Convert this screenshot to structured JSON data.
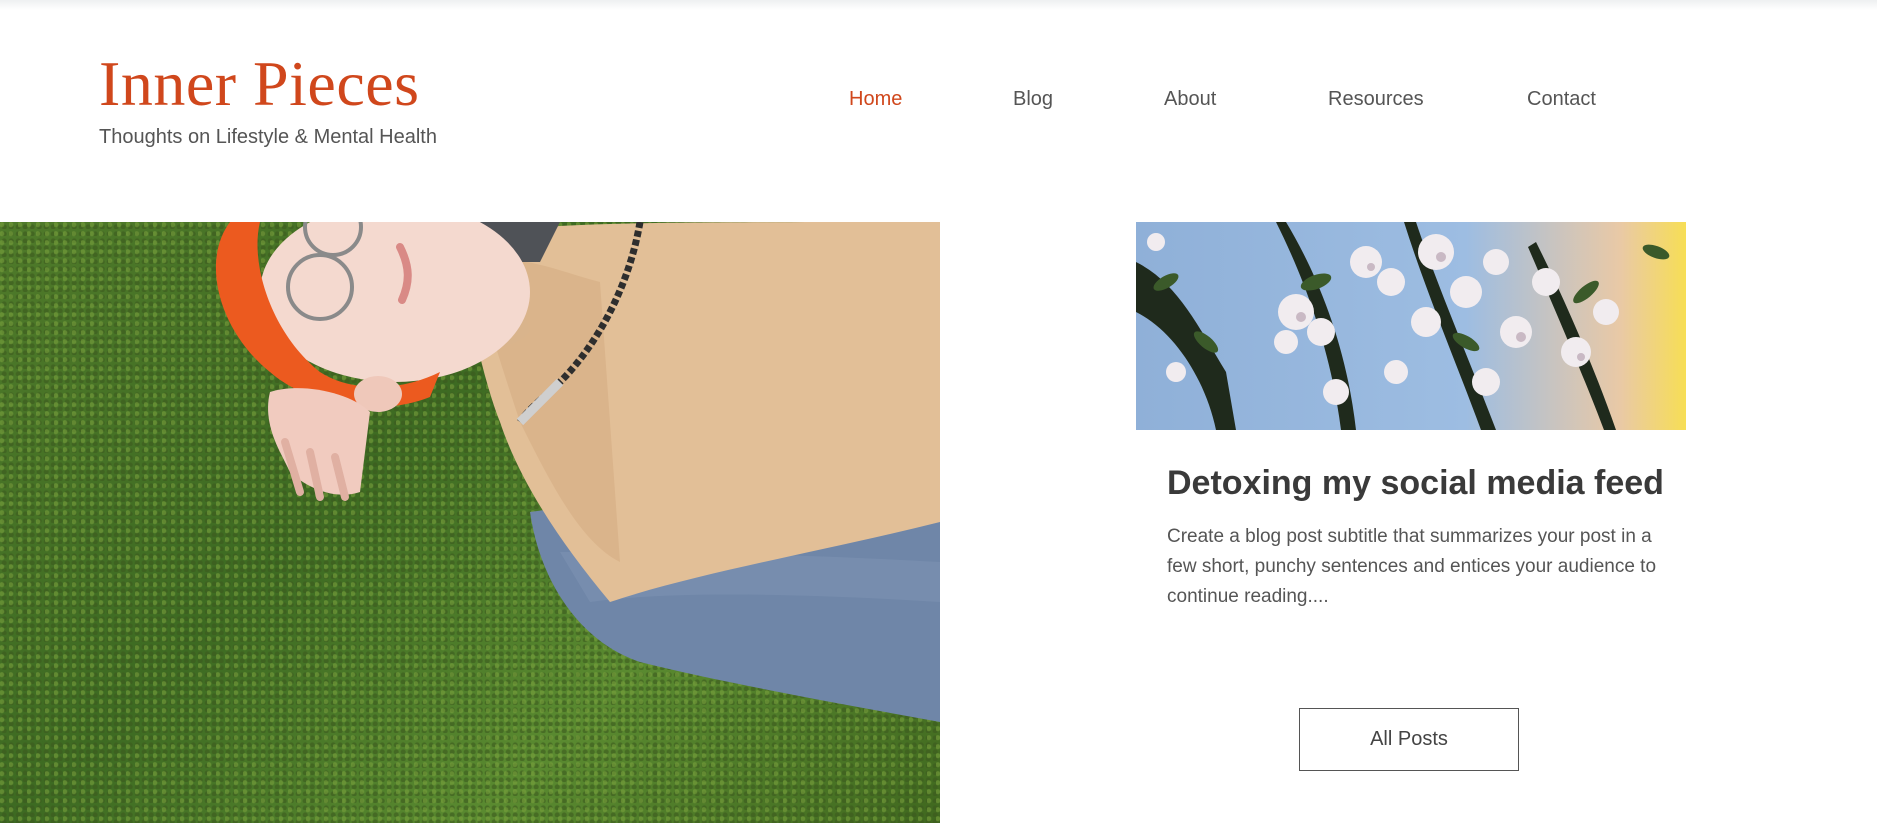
{
  "brand": {
    "title": "Inner Pieces",
    "subtitle": "Thoughts on Lifestyle & Mental Health"
  },
  "nav": {
    "items": [
      {
        "label": "Home",
        "active": true
      },
      {
        "label": "Blog",
        "active": false
      },
      {
        "label": "About",
        "active": false
      },
      {
        "label": "Resources",
        "active": false
      },
      {
        "label": "Contact",
        "active": false
      }
    ]
  },
  "hero": {
    "image_alt": "Person lying on grass wearing an orange beanie and glasses"
  },
  "post": {
    "image_alt": "White blossoms against a blue sky",
    "title": "Detoxing my social media feed",
    "subtitle": "Create a blog post subtitle that summarizes your post in a few short, punchy sentences and entices your audience to continue reading...."
  },
  "buttons": {
    "all_posts": "All Posts"
  },
  "colors": {
    "accent": "#d0471c",
    "text": "#555555",
    "background": "#ffffff"
  }
}
